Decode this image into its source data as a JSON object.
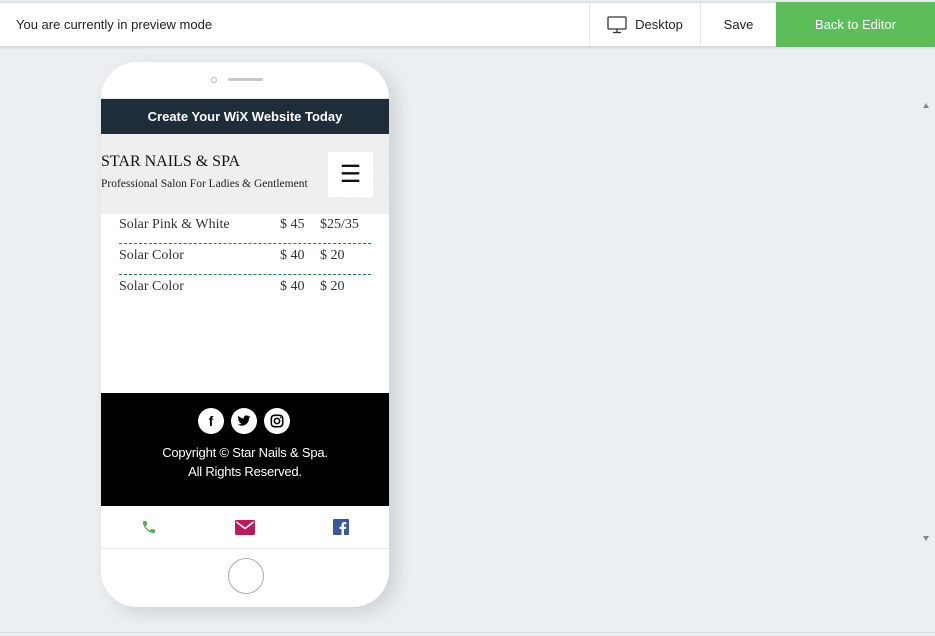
{
  "preview_bar": {
    "message": "You are currently in preview mode",
    "desktop_label": "Desktop",
    "save_label": "Save",
    "back_label": "Back to Editor",
    "accent": "#5cbd5b"
  },
  "site": {
    "wix_banner": "Create Your WiX Website Today",
    "title": "STAR NAILS & SPA",
    "subtitle": "Professional Salon For Ladies & Gentlement",
    "menu_icon": "hamburger-icon",
    "price_rows": [
      {
        "name": "Solar Pink & White",
        "price_a": "$ 45",
        "price_b": "$25/35"
      },
      {
        "name": "Solar Color",
        "price_a": "$ 40",
        "price_b": "$ 20"
      },
      {
        "name": "Solar Color",
        "price_a": "$ 40",
        "price_b": "$ 20"
      }
    ],
    "footer": {
      "socials": [
        "facebook-icon",
        "twitter-icon",
        "instagram-icon"
      ],
      "copyright_line1": "Copyright © Star Nails & Spa.",
      "copyright_line2": "All Rights Reserved."
    },
    "action_bar": {
      "phone_color": "#4caf50",
      "email_color": "#c2185b",
      "facebook_color": "#3b5998"
    }
  }
}
